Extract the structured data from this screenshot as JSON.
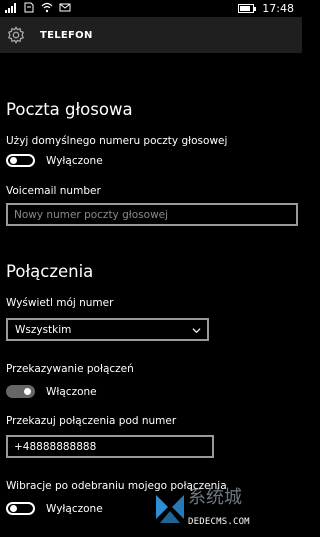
{
  "status_bar": {
    "time": "17:48",
    "icons": [
      "signal-icon",
      "sim-icon",
      "wifi-icon",
      "message-icon"
    ]
  },
  "header": {
    "title": "TELEFON",
    "icon": "gear-icon"
  },
  "voicemail": {
    "section_title": "Poczta głosowa",
    "use_default_label": "Użyj domyślnego numeru poczty głosowej",
    "use_default_state": "Wyłączone",
    "use_default_on": false,
    "number_label": "Voicemail number",
    "number_placeholder": "Nowy numer poczty głosowej"
  },
  "calls": {
    "section_title": "Połączenia",
    "show_number_label": "Wyświetl mój numer",
    "show_number_value": "Wszystkim",
    "forwarding_label": "Przekazywanie połączeń",
    "forwarding_state": "Włączone",
    "forwarding_on": true,
    "forward_to_label": "Przekazuj połączenia pod numer",
    "forward_to_value": "+48888888888",
    "vibrate_label": "Wibracje po odebraniu mojego połączenia",
    "vibrate_state": "Wyłączone",
    "vibrate_on": false
  },
  "watermark": {
    "text": "系统城",
    "url": "DEDECMS.COM"
  }
}
